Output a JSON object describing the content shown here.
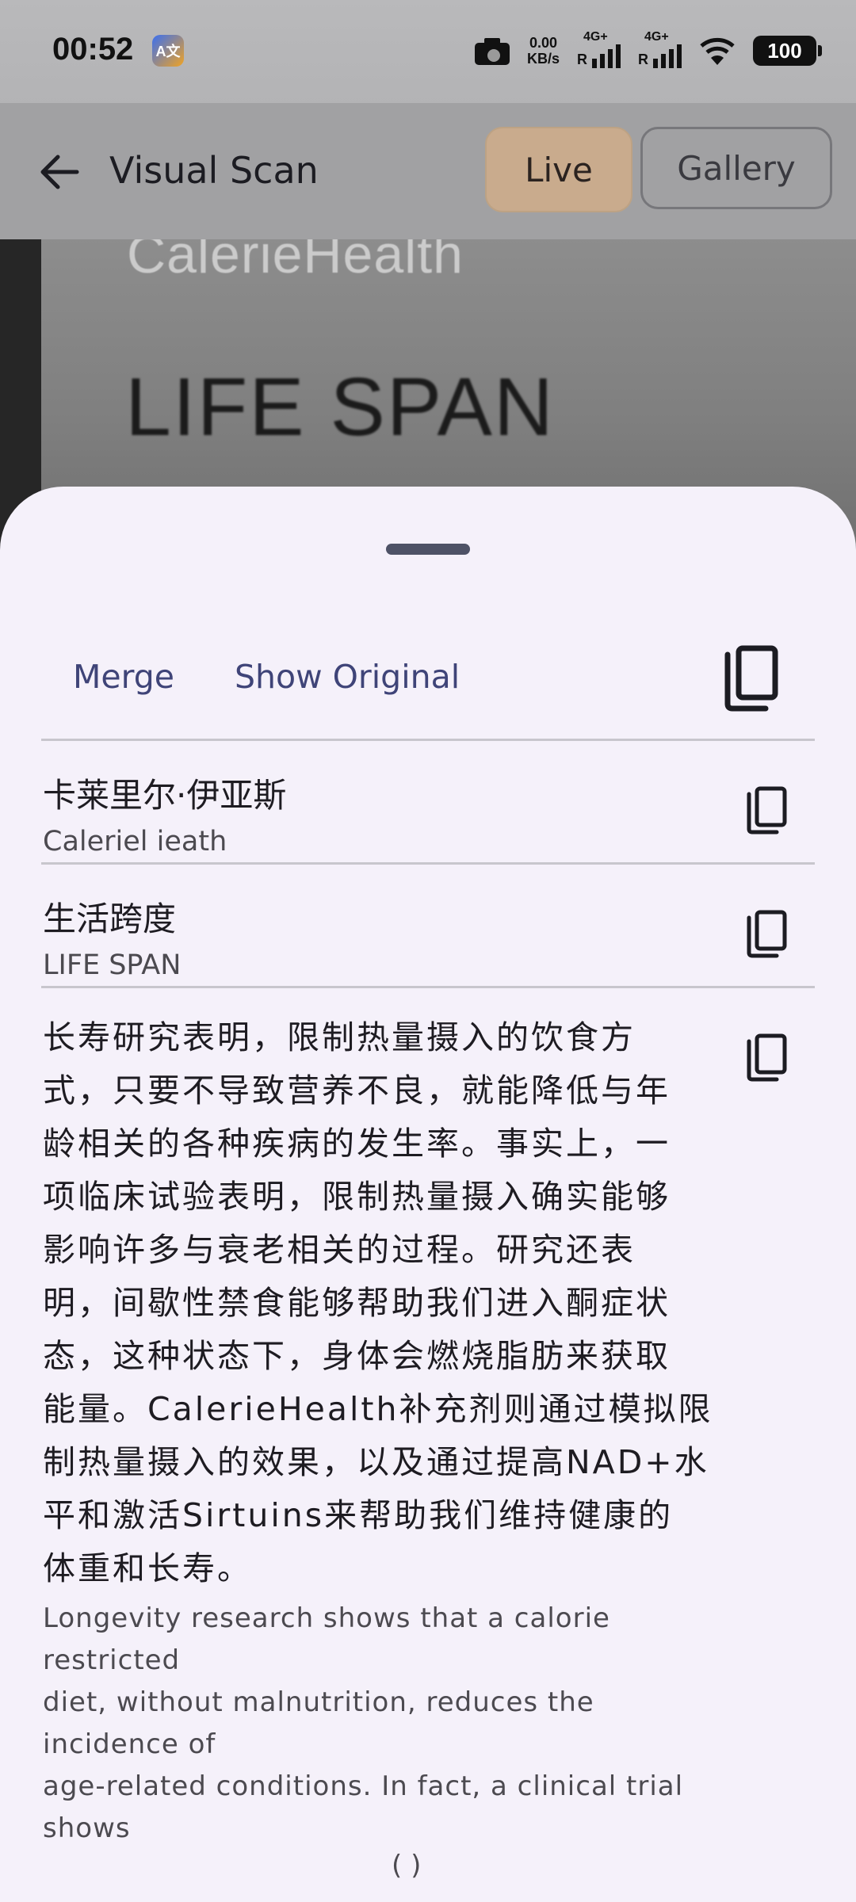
{
  "status_bar": {
    "time": "00:52",
    "app_badge_text": "A文",
    "net_speed_value": "0.00",
    "net_speed_unit": "KB/s",
    "sim1_label": "4G+",
    "sim2_label": "4G+",
    "sim_r": "R",
    "battery": "100",
    "icons": [
      "camera-icon",
      "signal-icon",
      "wifi-icon",
      "battery-icon"
    ]
  },
  "camera_view": {
    "brand_text": "CalerieHealth",
    "product_text": "LIFE SPAN"
  },
  "app_bar": {
    "title": "Visual Scan",
    "back_icon": "arrow-left-icon",
    "live_label": "Live",
    "gallery_label": "Gallery",
    "active_tab": "Live",
    "accent_color": "#c9ab8d"
  },
  "sheet": {
    "actions": {
      "merge_label": "Merge",
      "show_original_label": "Show Original",
      "copy_all_icon": "copy-icon"
    },
    "blocks": [
      {
        "translation": "卡莱里尔·伊亚斯",
        "original": "Caleriel ieath",
        "copy_icon": "copy-icon"
      },
      {
        "translation": "生活跨度",
        "original": "LIFE SPAN",
        "copy_icon": "copy-icon"
      }
    ],
    "paragraph": {
      "translation": "长寿研究表明，限制热量摄入的饮食方\n式，只要不导致营养不良，就能降低与年\n龄相关的各种疾病的发生率。事实上，一\n项临床试验表明，限制热量摄入确实能够\n影响许多与衰老相关的过程。研究还表\n明，间歇性禁食能够帮助我们进入酮症状\n态，这种状态下，身体会燃烧脂肪来获取\n能量。CalerieHealth补充剂则通过模拟限\n制热量摄入的效果，以及通过提高NAD+水\n平和激活Sirtuins来帮助我们维持健康的\n体重和长寿。",
      "original": "Longevity research shows that a calorie\nrestricted\ndiet, without malnutrition, reduces the\nincidence of\nage-related conditions. In fact, a clinical trial\nshows",
      "cut_fragment": "( )",
      "copy_icon": "copy-icon"
    }
  }
}
